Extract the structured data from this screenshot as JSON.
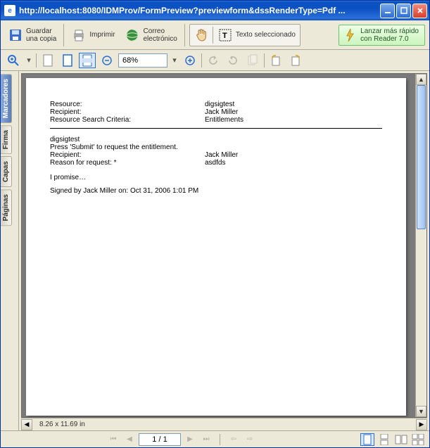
{
  "window": {
    "title": "http://localhost:8080/IDMProv/FormPreview?previewform&dssRenderType=Pdf ..."
  },
  "toolbar1": {
    "save_line1": "Guardar",
    "save_line2": "una copia",
    "print": "Imprimir",
    "email_line1": "Correo",
    "email_line2": "electrónico",
    "hand_tool": "",
    "text_select": "Texto seleccionado",
    "launch_line1": "Lanzar más rápido",
    "launch_line2": "con Reader 7.0"
  },
  "toolbar2": {
    "zoom_value": "68%"
  },
  "sidetabs": {
    "bookmarks": "Marcadores",
    "signature": "Firma",
    "layers": "Capas",
    "pages": "Páginas"
  },
  "document": {
    "labels": {
      "resource": "Resource:",
      "recipient": "Recipient:",
      "search_criteria": "Resource Search Criteria:"
    },
    "values": {
      "resource": "digsigtest",
      "recipient": "Jack Miller",
      "search_criteria": "Entitlements"
    },
    "body": {
      "line_resource": "digsigtest",
      "line_instruction": "Press 'Submit' to request the entitlement.",
      "recipient_label": "Recipient:",
      "recipient_value": "Jack Miller",
      "reason_label": "Reason for request: *",
      "reason_value": "asdfds",
      "promise": "I promise…",
      "signed": "Signed by Jack Miller on: Oct 31, 2006 1:01 PM"
    }
  },
  "status": {
    "page_dimensions": "8.26 x 11.69 in"
  },
  "pager": {
    "page_display": "1 / 1"
  }
}
